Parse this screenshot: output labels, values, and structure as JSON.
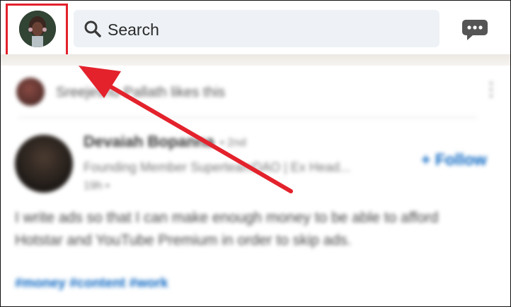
{
  "header": {
    "search_placeholder": "Search",
    "profile_avatar": "profile-photo",
    "messaging_icon": "chat-bubble-icon"
  },
  "feed": {
    "activity": {
      "text": "Sreejeshu Pallath likes this"
    },
    "post": {
      "author_name": "Devaiah Bopanna",
      "degree": "• 2nd",
      "headline": "Founding Member SuperteamDAO | Ex Head...",
      "time": "19h •",
      "follow_label": "+ Follow",
      "body": "I write ads so that I can make enough money to be able to afford Hotstar and YouTube Premium in order to skip ads.",
      "hashtags": "#money #content #work"
    }
  },
  "colors": {
    "highlight": "#e3222c",
    "link": "#0a66c2",
    "search_bg": "#eef2f6"
  }
}
